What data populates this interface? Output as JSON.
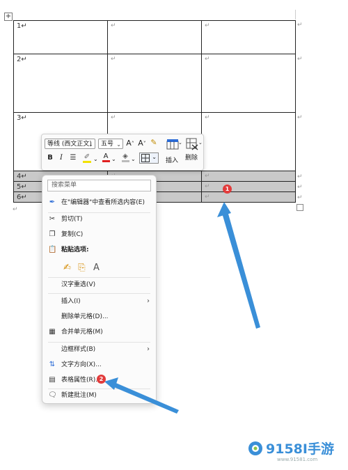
{
  "table": {
    "rows": [
      {
        "label": "1↵",
        "cells": [
          "↵",
          "↵"
        ]
      },
      {
        "label": "2↵",
        "cells": [
          "↵",
          "↵"
        ]
      },
      {
        "label": "3↵",
        "cells": [
          "↵",
          "↵"
        ]
      },
      {
        "label": "4↵",
        "cells": [
          "↵",
          "↵"
        ]
      },
      {
        "label": "5↵",
        "cells": [
          "↵",
          "↵"
        ]
      },
      {
        "label": "6↵",
        "cells": [
          "↵",
          "↵"
        ]
      }
    ],
    "end_mark": "↵"
  },
  "mini_toolbar": {
    "font_name": "等线 (西文正文)",
    "font_size": "五号",
    "grow_font": "A^",
    "shrink_font": "A˅",
    "bold": "B",
    "italic": "I",
    "align": "☰",
    "font_color_letter": "A",
    "insert_label": "插入",
    "delete_label": "删除",
    "colors": {
      "highlight": "#f2e200",
      "font_color": "#e02020",
      "accent": "#2b6bd6"
    }
  },
  "context_menu": {
    "search_placeholder": "搜索菜单",
    "items": [
      {
        "label": "在\"编辑器\"中查看所选内容(E)",
        "icon": "editor-pen-icon"
      },
      {
        "label": "剪切(T)",
        "icon": "scissors-icon"
      },
      {
        "label": "复制(C)",
        "icon": "copy-icon"
      },
      {
        "label": "粘贴选项:",
        "icon": "paste-icon"
      },
      {
        "label": "汉字重选(V)",
        "icon": ""
      },
      {
        "label": "插入(I)",
        "icon": "",
        "submenu": true
      },
      {
        "label": "删除单元格(D)...",
        "icon": ""
      },
      {
        "label": "合并单元格(M)",
        "icon": "merge-cells-icon"
      },
      {
        "label": "边框样式(B)",
        "icon": "",
        "submenu": true
      },
      {
        "label": "文字方向(X)...",
        "icon": "text-direction-icon"
      },
      {
        "label": "表格属性(R)...",
        "icon": "table-properties-icon"
      },
      {
        "label": "新建批注(M)",
        "icon": "new-comment-icon"
      }
    ]
  },
  "badges": {
    "first": "1",
    "second": "2"
  },
  "watermark": {
    "brand": "9158I手游",
    "url": "www.91581.com"
  }
}
